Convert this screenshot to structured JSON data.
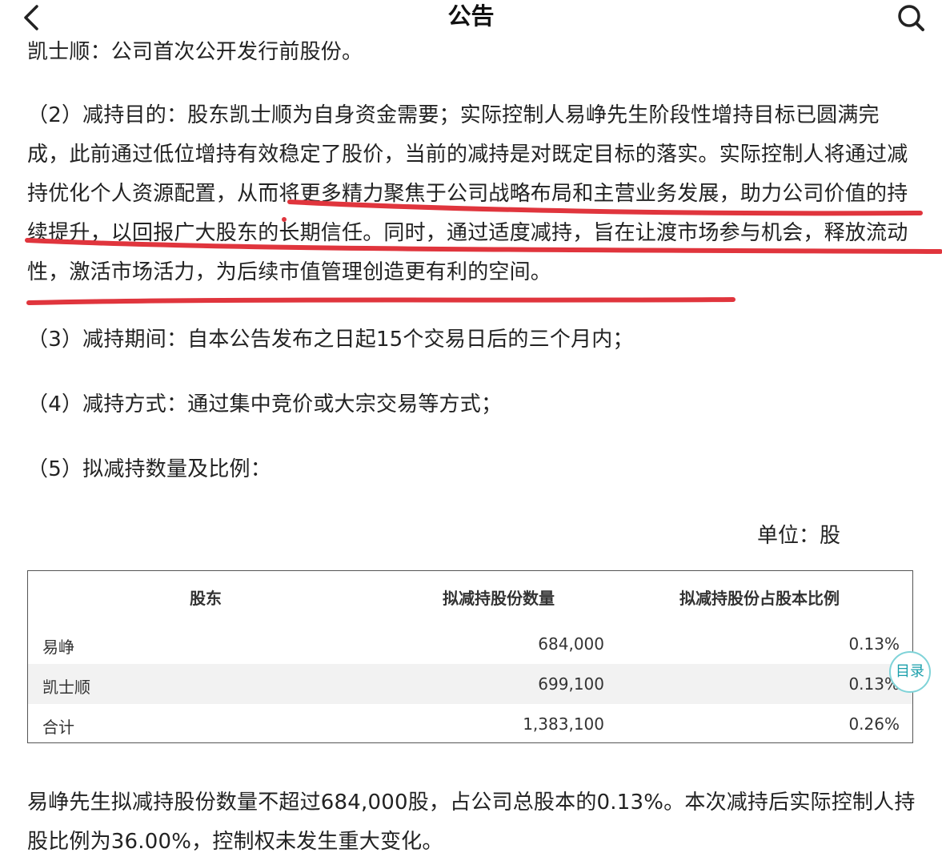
{
  "header": {
    "title": "公告",
    "back_icon": "chevron-left-icon",
    "search_icon": "search-icon"
  },
  "document": {
    "cut_line": "凯士顺：公司首次公开发行前股份。",
    "para2": "（2）减持目的：股东凯士顺为自身资金需要；实际控制人易峥先生阶段性增持目标已圆满完成，此前通过低位增持有效稳定了股价，当前的减持是对既定目标的落实。实际控制人将通过减持优化个人资源配置，从而将更多精力聚焦于公司战略布局和主营业务发展，助力公司价值的持续提升，以回报广大股东的长期信任。同时，通过适度减持，旨在让渡市场参与机会，释放流动性，激活市场活力，为后续市值管理创造更有利的空间。",
    "para3": "（3）减持期间：自本公告发布之日起15个交易日后的三个月内；",
    "para4": "（4）减持方式：通过集中竞价或大宗交易等方式；",
    "para5": "（5）拟减持数量及比例：",
    "unit": "单位：股",
    "table": {
      "headers": [
        "股东",
        "拟减持股份数量",
        "拟减持股份占股本比例"
      ],
      "rows": [
        [
          "易峥",
          "684,000",
          "0.13%"
        ],
        [
          "凯士顺",
          "699,100",
          "0.13%"
        ],
        [
          "合计",
          "1,383,100",
          "0.26%"
        ]
      ]
    },
    "closing": "易峥先生拟减持股份数量不超过684,000股，占公司总股本的0.13%。本次减持后实际控制人持股比例为36.00%，控制权未发生重大变化。"
  },
  "toc_button": {
    "label": "目录"
  },
  "colors": {
    "highlight_stroke": "#e0353d",
    "toc_accent": "#1a9fab"
  }
}
